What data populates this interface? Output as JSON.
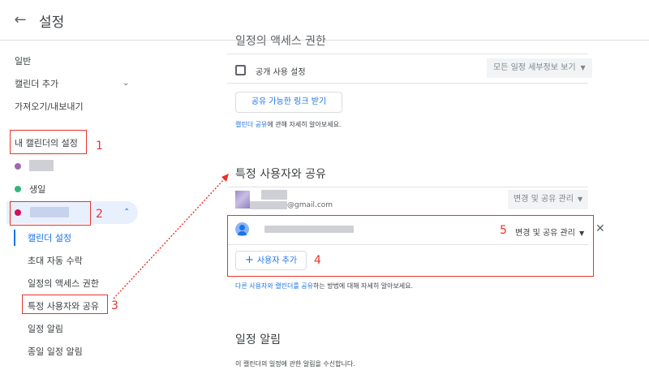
{
  "header": {
    "title": "설정"
  },
  "sidebar": {
    "general": "일반",
    "add_calendar": "캘린더 추가",
    "import_export": "가져오기/내보내기",
    "my_calendar_settings": "내 캘린더의 설정",
    "birthday": "생일",
    "sub_items": [
      "캘린더 설정",
      "초대 자동 수락",
      "일정의 액세스 권한",
      "특정 사용자와 공유",
      "일정 알림",
      "종일 일정 알림"
    ]
  },
  "access": {
    "public_label": "공개 사용 설정",
    "public_select": "모든 일정 세부정보 보기",
    "link_button": "공유 가능한 링크 받기",
    "help_link": "캘린더 공유",
    "help_text": "에 관해 자세히 알아보세요."
  },
  "share": {
    "title": "특정 사용자와 공유",
    "user1_email_suffix": "@gmail.com",
    "user1_perm": "변경 및 공유 관리",
    "user2_perm": "변경 및 공유 관리",
    "add_user": "사용자 추가",
    "help_link1": "다른 사용자와 캘린더를 공유",
    "help_text": "하는 방법에 대해 자세히 알아보세요."
  },
  "notifications": {
    "title": "일정 알림",
    "desc": "이 캘린더의 일정에 관한 알림을 수신합니다."
  },
  "annotations": [
    "1",
    "2",
    "3",
    "4",
    "5"
  ],
  "colors": {
    "accent": "#1a73e8",
    "annotation": "#e8332a",
    "purple_dot": "#9e69af",
    "green_dot": "#33b679",
    "red_dot": "#d50f57"
  }
}
